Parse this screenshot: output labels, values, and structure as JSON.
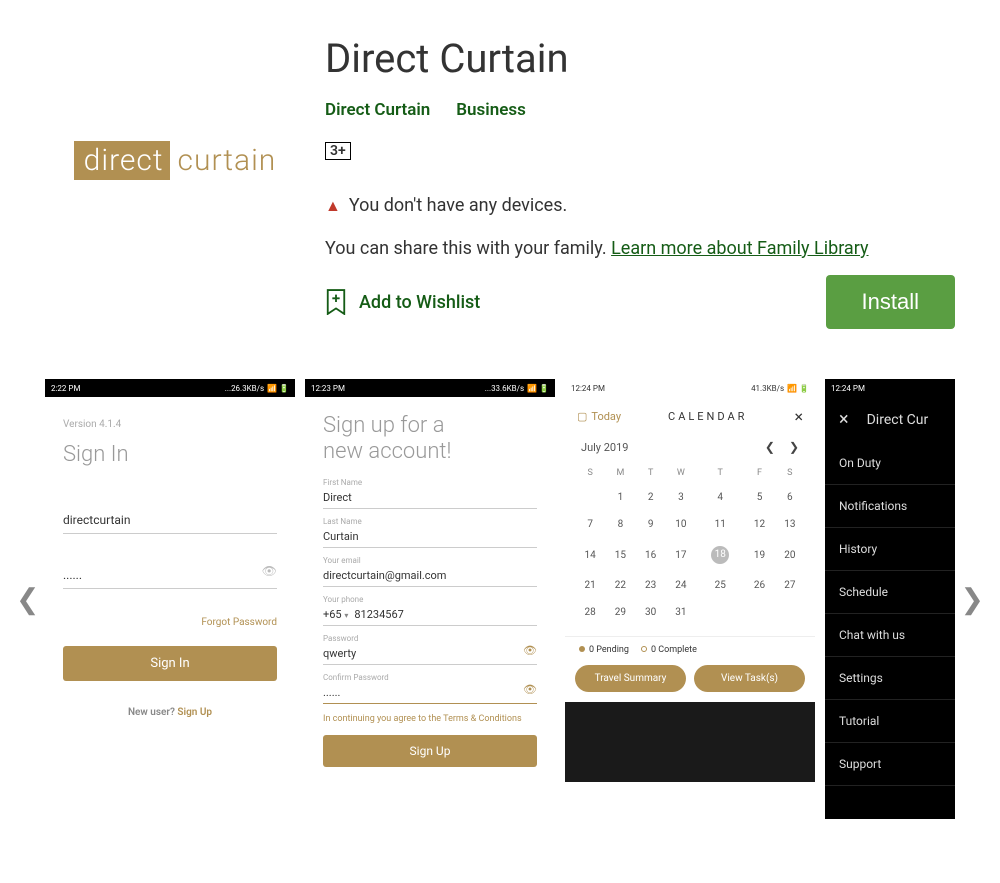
{
  "logo": {
    "left": "direct",
    "right": "curtain"
  },
  "app": {
    "title": "Direct Curtain",
    "developer": "Direct Curtain",
    "category": "Business",
    "rating": "3+",
    "warning": "You don't have any devices.",
    "share_prefix": "You can share this with your family. ",
    "share_link": "Learn more about Family Library",
    "wishlist": "Add to Wishlist",
    "install": "Install"
  },
  "shot1": {
    "time": "2:22 PM",
    "net": "...26.3KB/s",
    "version": "Version 4.1.4",
    "title": "Sign In",
    "username": "directcurtain",
    "password": "......",
    "forgot": "Forgot Password",
    "button": "Sign In",
    "new_user_pre": "New user? ",
    "new_user_link": "Sign Up"
  },
  "shot2": {
    "time": "12:23 PM",
    "net": "...33.6KB/s",
    "title_l1": "Sign up for a",
    "title_l2": "new account!",
    "labels": {
      "first": "First Name",
      "last": "Last Name",
      "email": "Your email",
      "phone": "Your phone",
      "pass": "Password",
      "confirm": "Confirm Password"
    },
    "first": "Direct",
    "last": "Curtain",
    "email": "directcurtain@gmail.com",
    "cc": "+65",
    "phone": "81234567",
    "pass": "qwerty",
    "confirm": "......",
    "terms_pre": "In continuing you agree to the ",
    "terms_link": "Terms & Conditions",
    "button": "Sign Up"
  },
  "shot3": {
    "time": "12:24 PM",
    "net": "41.3KB/s",
    "today": "Today",
    "cal": "CALENDAR",
    "month": "July 2019",
    "dow": [
      "S",
      "M",
      "T",
      "W",
      "T",
      "F",
      "S"
    ],
    "weeks": [
      [
        "",
        "1",
        "2",
        "3",
        "4",
        "5",
        "6"
      ],
      [
        "7",
        "8",
        "9",
        "10",
        "11",
        "12",
        "13"
      ],
      [
        "14",
        "15",
        "16",
        "17",
        "18",
        "19",
        "20"
      ],
      [
        "21",
        "22",
        "23",
        "24",
        "25",
        "26",
        "27"
      ],
      [
        "28",
        "29",
        "30",
        "31",
        "",
        "",
        ""
      ]
    ],
    "today_day": "18",
    "pending": "0  Pending",
    "complete": "0  Complete",
    "btn1": "Travel Summary",
    "btn2": "View Task(s)"
  },
  "shot4": {
    "time": "12:24 PM",
    "title": "Direct Cur",
    "items": [
      "On Duty",
      "Notifications",
      "History",
      "Schedule",
      "Chat with us",
      "Settings",
      "Tutorial",
      "Support"
    ]
  }
}
